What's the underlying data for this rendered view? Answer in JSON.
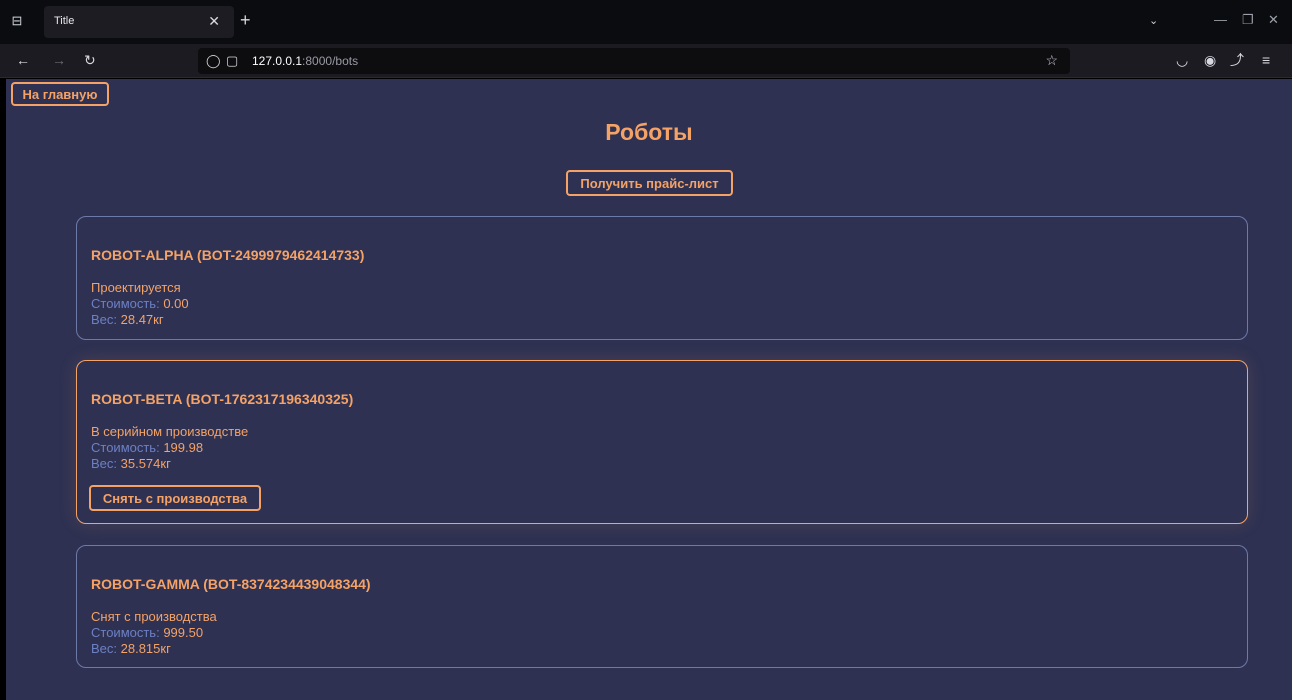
{
  "browser": {
    "tab_title": "Title",
    "url_host": "127.0.0.1",
    "url_path": ":8000/bots"
  },
  "page": {
    "home_button": "На главную",
    "title": "Роботы",
    "price_button": "Получить прайс-лист",
    "cost_label": "Стоимость: ",
    "weight_label": "Вес: ",
    "robots": [
      {
        "name": "ROBOT-ALPHA (BOT-2499979462414733)",
        "status": "Проектируется",
        "cost": "0.00",
        "weight": "28.47кг"
      },
      {
        "name": "ROBOT-BETA (BOT-1762317196340325)",
        "status": "В серийном производстве",
        "cost": "199.98",
        "weight": "35.574кг",
        "action": "Снять с производства"
      },
      {
        "name": "ROBOT-GAMMA (BOT-8374234439048344)",
        "status": "Снят с производства",
        "cost": "999.50",
        "weight": "28.815кг"
      }
    ]
  },
  "colors": {
    "accent": "#f4a266",
    "label": "#6d80c4",
    "background": "#2e3152",
    "card_border": "#6d7aa8"
  }
}
